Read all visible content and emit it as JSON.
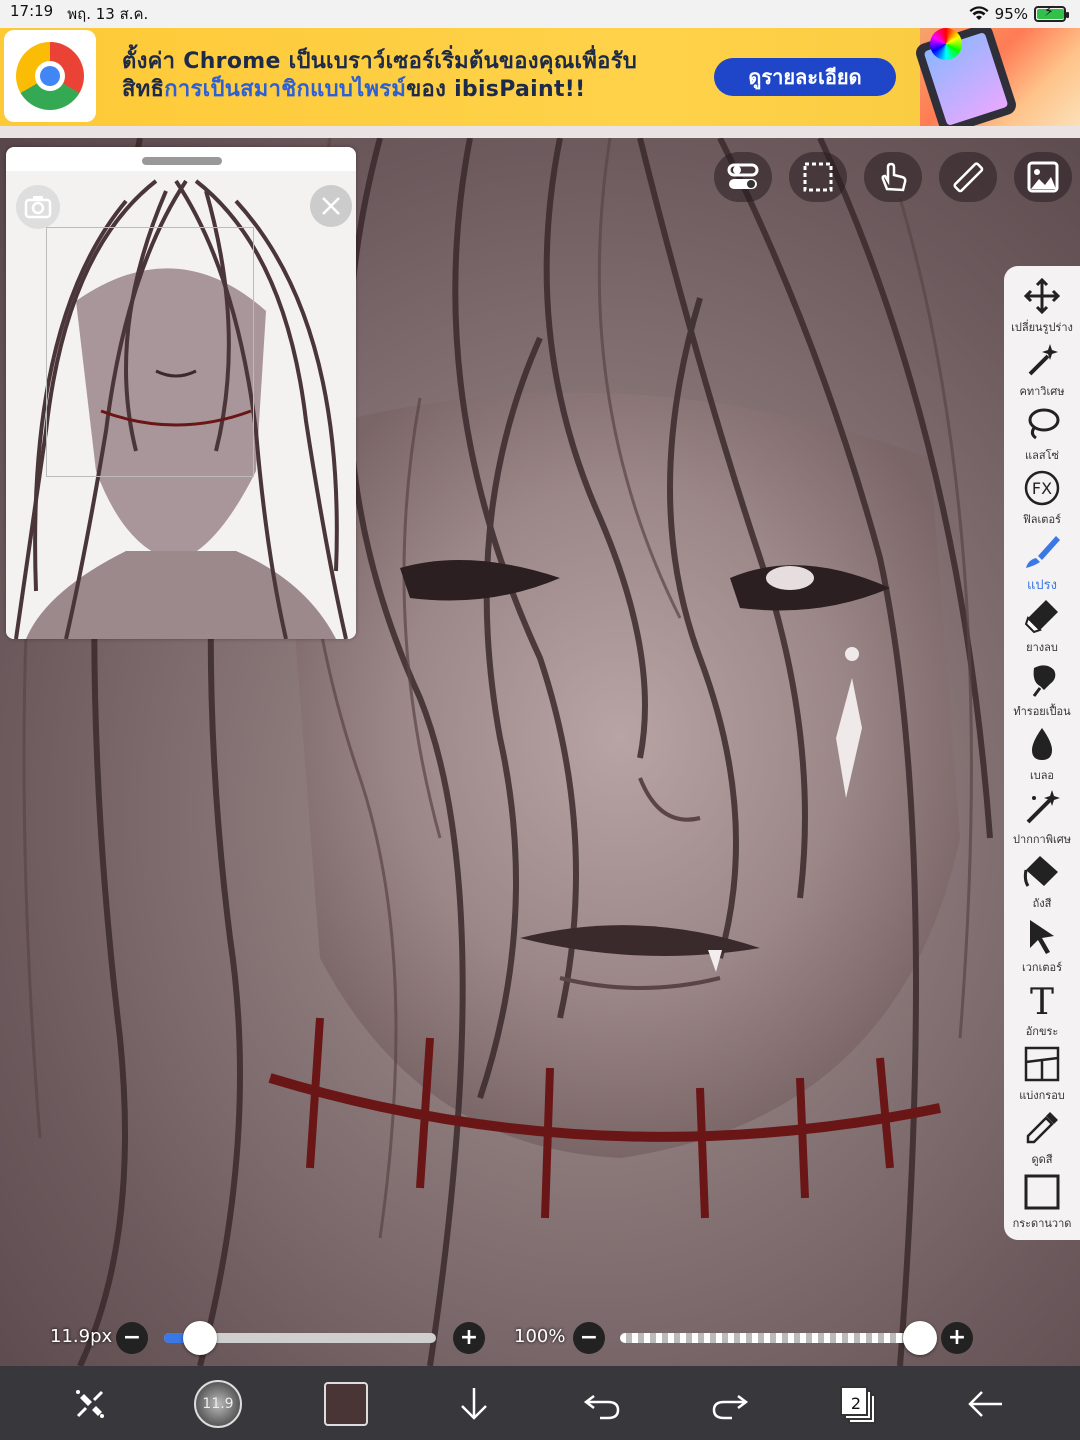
{
  "status_bar": {
    "time": "17:19",
    "date": "พฤ. 13 ส.ค.",
    "battery_text": "95%",
    "battery_level": 0.95
  },
  "banner": {
    "line1": "ตั้งค่า Chrome เป็นเบราว์เซอร์เริ่มต้นของคุณเพื่อรับ",
    "line2_prefix": "สิทธิ",
    "line2_highlight": "การเป็นสมาชิกแบบไพรม์",
    "line2_suffix": "ของ ibisPaint!!",
    "button_label": "ดูรายละเอียด"
  },
  "top_toolbar": {
    "items": [
      {
        "name": "toggle-icon"
      },
      {
        "name": "selection-icon"
      },
      {
        "name": "hand-icon"
      },
      {
        "name": "ruler-icon"
      },
      {
        "name": "gallery-icon"
      }
    ]
  },
  "tools": [
    {
      "label": "เปลี่ยนรูปร่าง",
      "icon": "move-icon"
    },
    {
      "label": "คทาวิเศษ",
      "icon": "magic-wand-icon"
    },
    {
      "label": "แลสโซ่",
      "icon": "lasso-icon"
    },
    {
      "label": "ฟิลเตอร์",
      "icon": "fx-icon"
    },
    {
      "label": "แปรง",
      "icon": "brush-icon",
      "active": true
    },
    {
      "label": "ยางลบ",
      "icon": "eraser-icon"
    },
    {
      "label": "ทำรอยเปื้อน",
      "icon": "smudge-icon"
    },
    {
      "label": "เบลอ",
      "icon": "blur-icon"
    },
    {
      "label": "ปากกาพิเศษ",
      "icon": "special-pen-icon"
    },
    {
      "label": "ถังสี",
      "icon": "bucket-icon"
    },
    {
      "label": "เวกเตอร์",
      "icon": "vector-icon"
    },
    {
      "label": "อักขระ",
      "icon": "text-icon"
    },
    {
      "label": "แบ่งกรอบ",
      "icon": "frame-divider-icon"
    },
    {
      "label": "ดูดสี",
      "icon": "eyedropper-icon"
    },
    {
      "label": "กระดานวาด",
      "icon": "canvas-icon"
    }
  ],
  "navigator": {
    "camera_icon": "camera-icon",
    "close_icon": "close-icon"
  },
  "brush_size": {
    "label": "11.9px",
    "minus": "−",
    "plus": "+",
    "level": 0.08
  },
  "opacity": {
    "label": "100%",
    "minus": "−",
    "plus": "+",
    "level": 1.0
  },
  "bottom_bar": {
    "brush_size_short": "11.9",
    "layer_count": "2",
    "color_hex": "#4a3536"
  },
  "colors": {
    "accent": "#3a78e6",
    "banner_button": "#1f46c9",
    "banner_bg": "#fdc936"
  }
}
